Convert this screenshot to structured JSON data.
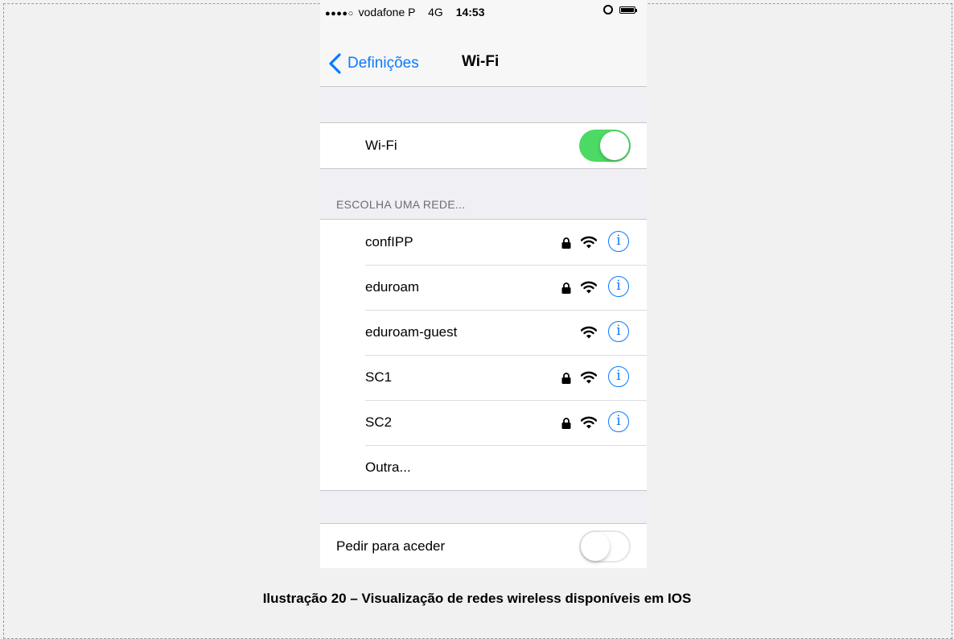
{
  "status_bar": {
    "signal_dots": "●●●●○",
    "carrier": "vodafone P",
    "network": "4G",
    "time": "14:53",
    "icons": [
      "alarm-icon",
      "battery-icon"
    ]
  },
  "nav": {
    "back_label": "Definições",
    "title": "Wi-Fi"
  },
  "wifi_toggle": {
    "label": "Wi-Fi",
    "on": true
  },
  "networks_header": "ESCOLHA UMA REDE...",
  "networks": [
    {
      "name": "confIPP",
      "locked": true
    },
    {
      "name": "eduroam",
      "locked": true
    },
    {
      "name": "eduroam-guest",
      "locked": false
    },
    {
      "name": "SC1",
      "locked": true
    },
    {
      "name": "SC2",
      "locked": true
    }
  ],
  "other_label": "Outra...",
  "ask_to_join": {
    "label": "Pedir para aceder",
    "on": false
  },
  "caption": "Ilustração 20 – Visualização de redes wireless disponíveis em IOS",
  "colors": {
    "accent": "#0a7aff",
    "toggle_on": "#4cd964",
    "grouped_background": "#efeff4"
  }
}
